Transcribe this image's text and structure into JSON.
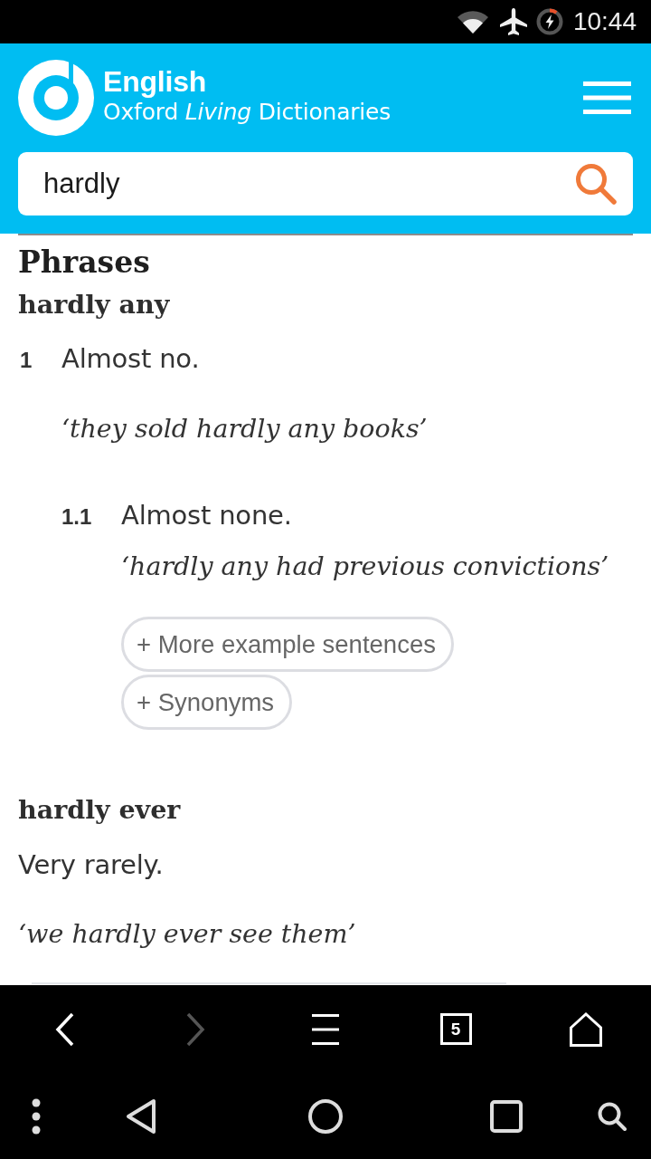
{
  "status_bar": {
    "time": "10:44"
  },
  "header": {
    "logo": {
      "title": "English",
      "subtitle": "Oxford *Living* Dictionaries"
    },
    "search": {
      "value": "hardly"
    }
  },
  "section": {
    "title": "Phrases",
    "phrases": [
      {
        "headword": "hardly any",
        "senses": [
          {
            "number": "1",
            "definition": "Almost no.",
            "examples": [
              "‘they sold hardly any books’"
            ],
            "subsenses": [
              {
                "number": "1.1",
                "definition": "Almost none.",
                "examples": [
                  "‘hardly any had previous convictions’"
                ],
                "buttons": [
                  "+ More example sentences",
                  "+ Synonyms"
                ]
              }
            ]
          }
        ]
      },
      {
        "headword": "hardly ever",
        "senses": [
          {
            "definition": "Very rarely.",
            "examples": [
              "‘we hardly ever see them’"
            ]
          }
        ]
      }
    ]
  },
  "browser_toolbar": {
    "items": [
      {
        "kind": "back",
        "disabled": false
      },
      {
        "kind": "forward",
        "disabled": true
      },
      {
        "kind": "menu",
        "disabled": false
      },
      {
        "kind": "tabs",
        "count": "5",
        "disabled": false
      },
      {
        "kind": "home",
        "disabled": false
      }
    ]
  },
  "nav_bar": {
    "items": [
      {
        "kind": "overflow"
      },
      {
        "kind": "back"
      },
      {
        "kind": "home"
      },
      {
        "kind": "recents"
      },
      {
        "kind": "search"
      }
    ]
  }
}
